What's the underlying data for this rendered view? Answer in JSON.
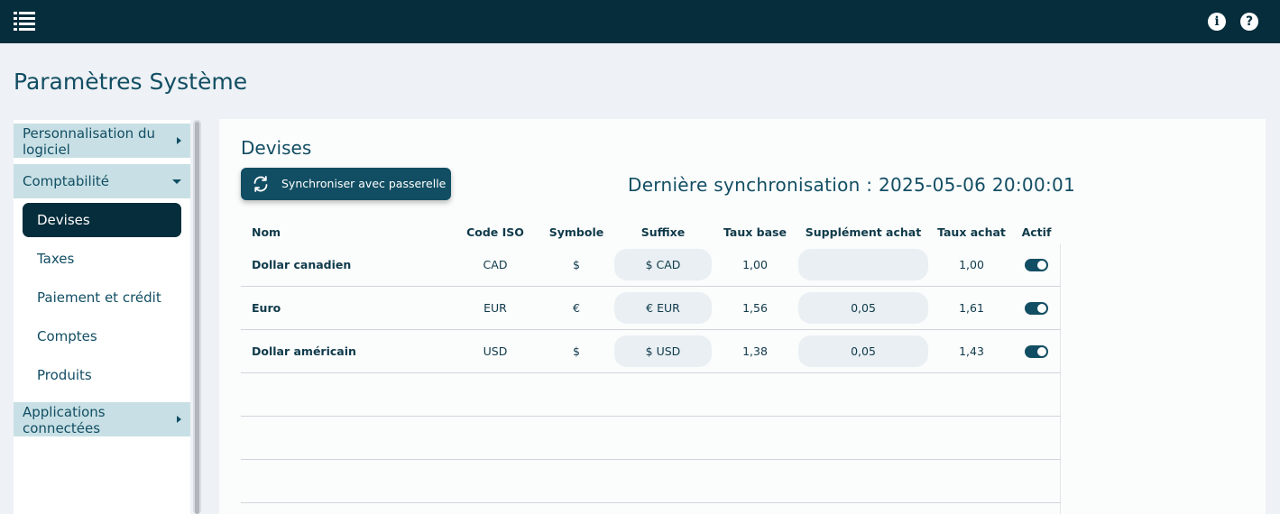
{
  "topbar": {
    "menu_icon": "list-icon",
    "info_icon": "info-icon",
    "help_icon": "help-icon",
    "info_glyph": "i",
    "help_glyph": "?"
  },
  "page": {
    "title": "Paramètres Système"
  },
  "sidebar": {
    "groups": [
      {
        "label": "Personnalisation du logiciel",
        "expanded": false
      },
      {
        "label": "Comptabilité",
        "expanded": true
      },
      {
        "label": "Applications connectées",
        "expanded": false
      }
    ],
    "items": [
      {
        "label": "Devises",
        "active": true
      },
      {
        "label": "Taxes",
        "active": false
      },
      {
        "label": "Paiement et crédit",
        "active": false
      },
      {
        "label": "Comptes",
        "active": false
      },
      {
        "label": "Produits",
        "active": false
      }
    ]
  },
  "panel": {
    "title": "Devises",
    "sync_button": "Synchroniser avec passerelle",
    "last_sync": "Dernière synchronisation : 2025-05-06 20:00:01"
  },
  "table": {
    "columns": [
      "Nom",
      "Code ISO",
      "Symbole",
      "Suffixe",
      "Taux base",
      "Supplément achat",
      "Taux achat",
      "Actif"
    ],
    "rows": [
      {
        "nom": "Dollar canadien",
        "code": "CAD",
        "symbole": "$",
        "suffixe": "$ CAD",
        "taux_base": "1,00",
        "supplement": "",
        "taux_achat": "1,00",
        "actif": true
      },
      {
        "nom": "Euro",
        "code": "EUR",
        "symbole": "€",
        "suffixe": "€ EUR",
        "taux_base": "1,56",
        "supplement": "0,05",
        "taux_achat": "1,61",
        "actif": true
      },
      {
        "nom": "Dollar américain",
        "code": "USD",
        "symbole": "$",
        "suffixe": "$ USD",
        "taux_base": "1,38",
        "supplement": "0,05",
        "taux_achat": "1,43",
        "actif": true
      }
    ]
  },
  "colors": {
    "topbar": "#062d3b",
    "accent": "#124e63",
    "group_bg": "#c8e0e5",
    "background": "#eef1f5"
  }
}
